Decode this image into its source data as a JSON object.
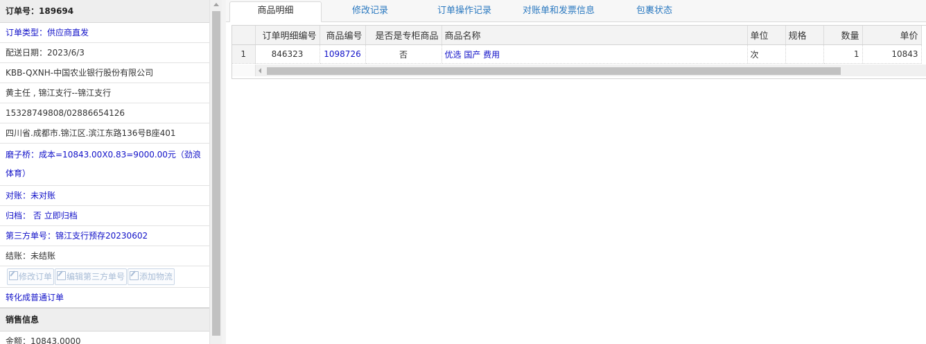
{
  "order": {
    "order_no_label": "订单号：",
    "order_no": "189694",
    "type_text": "订单类型：供应商直发",
    "delivery_date_text": "配送日期：2023/6/3",
    "customer": "KBB-QXNH-中国农业银行股份有限公司",
    "contact": "黄主任 , 锦江支行--锦江支行",
    "phones": "15328749808/02886654126",
    "address": "四川省.成都市.锦江区.滨江东路136号B座401",
    "supplier_cost_text": "磨子桥：成本=10843.00X0.83=9000.00元（劲浪体育）",
    "reconcile_label": "对账：",
    "reconcile_value": "未对账",
    "archive_label": "归档：",
    "archive_value": "否",
    "archive_action": "立即归档",
    "third_party_label": "第三方单号：",
    "third_party_value": "锦江支行预存20230602",
    "settle_label": "结账：",
    "settle_value": "未结账",
    "buttons": {
      "edit_order": "修改订单",
      "edit_third_party": "编辑第三方单号",
      "add_logistics": "添加物流"
    },
    "convert_link": "转化成普通订单",
    "sales_section_title": "销售信息",
    "amount_text": "金额：10843.0000"
  },
  "tabs": [
    "商品明细",
    "修改记录",
    "订单操作记录",
    "对账单和发票信息",
    "包裹状态"
  ],
  "active_tab": "商品明细",
  "grid": {
    "columns": [
      "订单明细编号",
      "商品编号",
      "是否是专柜商品",
      "商品名称",
      "单位",
      "规格",
      "数量",
      "单价"
    ],
    "rows": [
      {
        "rownum": "1",
        "detail_id": "846323",
        "product_id": "1098726",
        "is_counter": "否",
        "name": "优选 国产 费用",
        "unit": "次",
        "spec": "",
        "qty": "1",
        "price": "10843"
      }
    ]
  },
  "colors": {
    "link": "#1010c8",
    "tab_link": "#2b79c0"
  }
}
